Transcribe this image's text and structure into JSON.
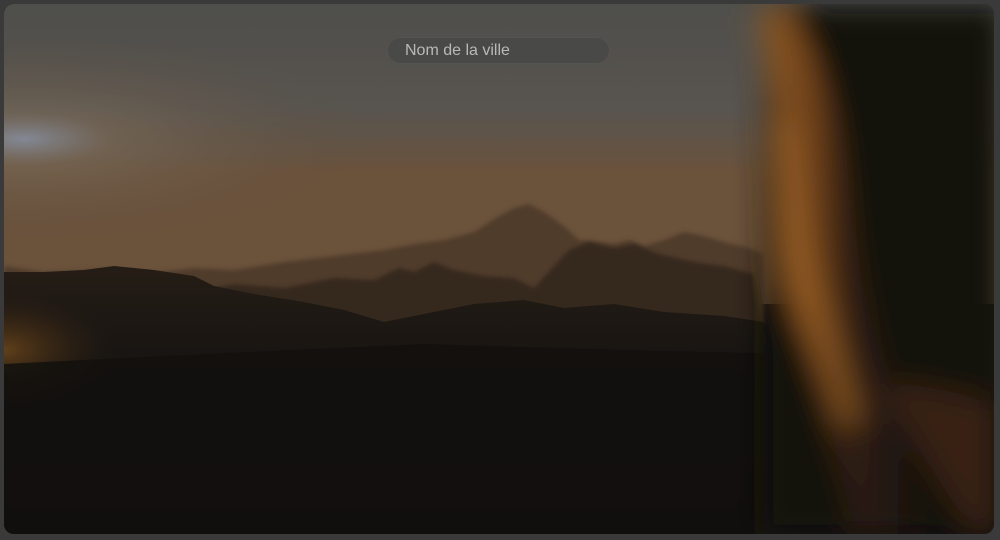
{
  "search": {
    "placeholder": "Nom de la ville",
    "value": "",
    "button_icon": "search-icon"
  },
  "background": {
    "icon": "mountain-sunset-photo"
  },
  "colors": {
    "search_bar_bg": "#484848",
    "search_button_bg": "#8c8c8c",
    "placeholder_text": "#b9b9b9",
    "sky_top": "#5c5c57",
    "glow": "#d98a3a"
  }
}
